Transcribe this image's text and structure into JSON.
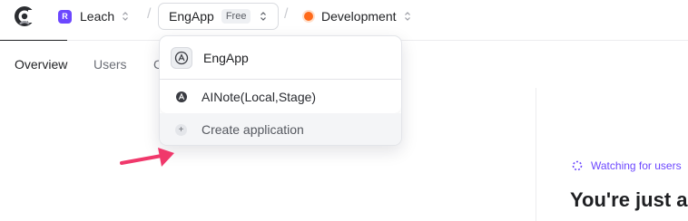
{
  "topbar": {
    "org": {
      "badge": "R",
      "name": "Leach"
    },
    "separator": "/",
    "app": {
      "name": "EngApp",
      "plan_badge": "Free"
    },
    "environment": {
      "name": "Development",
      "dot_color": "#ff6a1a"
    }
  },
  "tabs": [
    {
      "label": "Overview",
      "active": true
    },
    {
      "label": "Users",
      "active": false
    },
    {
      "label": "C",
      "active": false
    }
  ],
  "dropdown": {
    "current_app": "EngApp",
    "other_apps": [
      "AINote(Local,Stage)"
    ],
    "create_label": "Create application"
  },
  "main": {
    "status": "Watching for users",
    "headline": "You're just a"
  },
  "colors": {
    "accent": "#6c47ff",
    "annotation_arrow": "#f0386b"
  }
}
